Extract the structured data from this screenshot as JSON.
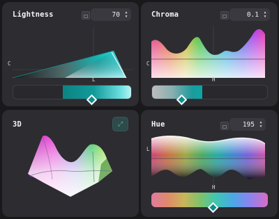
{
  "panels": {
    "lightness": {
      "title": "Lightness",
      "value": "70",
      "axis_left": "C",
      "axis_bottom": "L"
    },
    "chroma": {
      "title": "Chroma",
      "value": "0.1",
      "axis_left": "C",
      "axis_bottom": "H"
    },
    "three_d": {
      "title": "3D",
      "expand_icon": "expand-icon"
    },
    "hue": {
      "title": "Hue",
      "value": "195",
      "axis_left": "L",
      "axis_bottom": "H"
    }
  },
  "stepper_glyphs": {
    "up": "▲",
    "down": "▼"
  },
  "colors": {
    "accent": "#0d8e8e",
    "panel_bg": "#2d2c31",
    "page_bg": "#19191b",
    "field_bg": "#3a3940"
  }
}
